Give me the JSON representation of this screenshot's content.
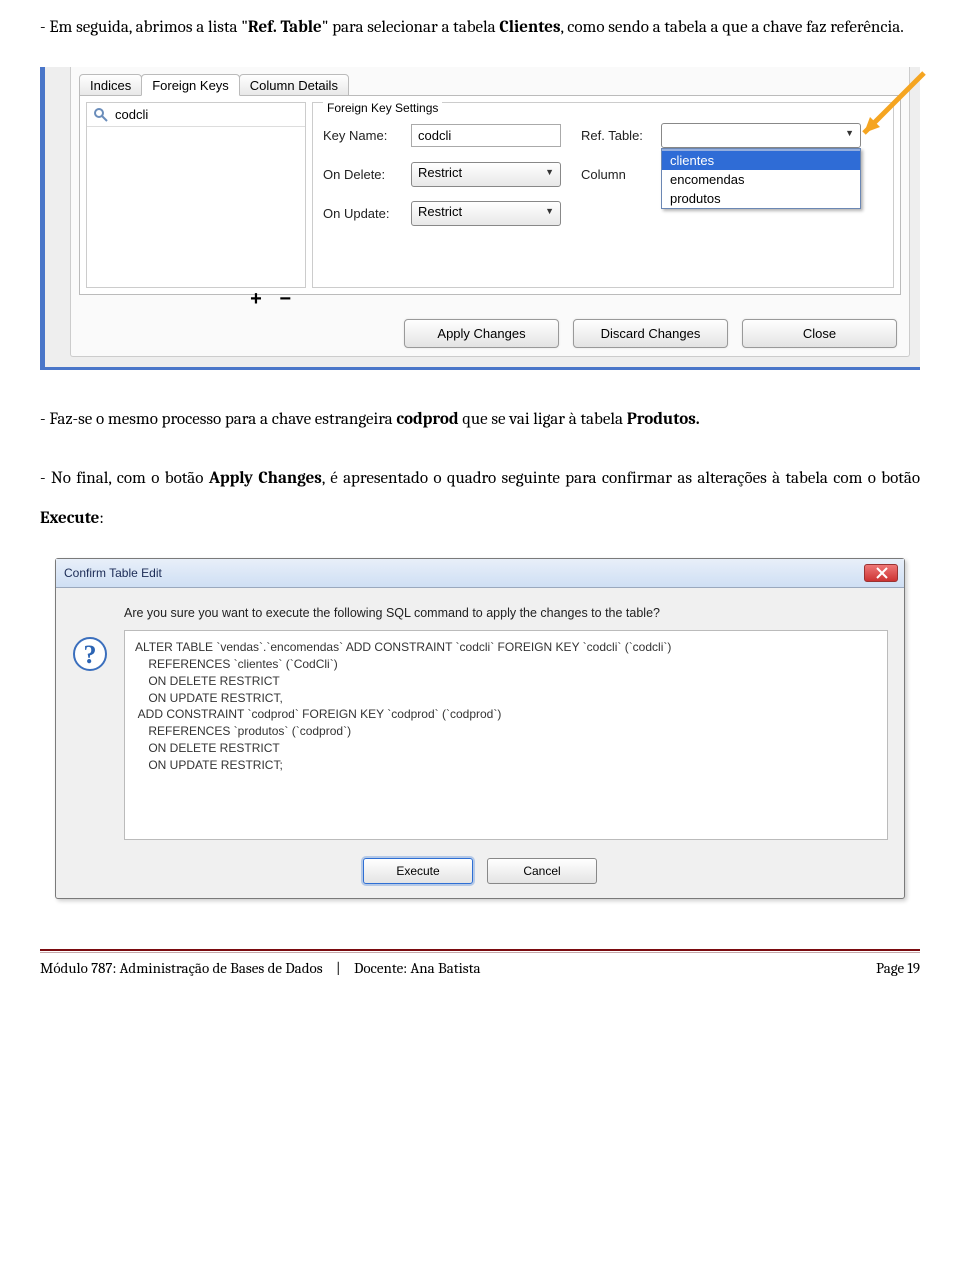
{
  "para1_a": "- Em seguida, abrimos a lista \"",
  "para1_b1": "Ref. Table",
  "para1_c": "\" para selecionar a tabela ",
  "para1_b2": "Clientes",
  "para1_d": ", como sendo a tabela a que a chave faz referência.",
  "shot1": {
    "tabs": {
      "t0": "Indices",
      "t1": "Foreign Keys",
      "t2": "Column Details"
    },
    "fk_item": "codcli",
    "plusminus": "+  −",
    "groupTitle": "Foreign Key Settings",
    "lbl_keyname": "Key Name:",
    "keyname_val": "codcli",
    "lbl_reftable": "Ref. Table:",
    "reftable_val": "",
    "lbl_col": "Column",
    "lbl_ondelete": "On Delete:",
    "ondelete_val": "Restrict",
    "lbl_onupdate": "On Update:",
    "onupdate_val": "Restrict",
    "dd": {
      "o0": "clientes",
      "o1": "encomendas",
      "o2": "produtos"
    },
    "btn_apply": "Apply Changes",
    "btn_discard": "Discard Changes",
    "btn_close": "Close"
  },
  "para2_a": "- Faz-se o mesmo processo para a chave estrangeira ",
  "para2_b1": "codprod",
  "para2_c": " que se vai ligar à tabela ",
  "para2_b2": "Produtos.",
  "para3_a": "- No final, com o botão ",
  "para3_b1": "Apply Changes",
  "para3_c": ", é apresentado o quadro seguinte para confirmar as alterações à tabela com o botão ",
  "para3_b2": "Execute",
  "para3_d": ":",
  "dlg": {
    "title": "Confirm Table Edit",
    "prompt": "Are you sure you want to execute the following SQL command to apply the changes to the table?",
    "sql": "ALTER TABLE `vendas`.`encomendas` ADD CONSTRAINT `codcli` FOREIGN KEY `codcli` (`codcli`)\n    REFERENCES `clientes` (`CodCli`)\n    ON DELETE RESTRICT\n    ON UPDATE RESTRICT,\n ADD CONSTRAINT `codprod` FOREIGN KEY `codprod` (`codprod`)\n    REFERENCES `produtos` (`codprod`)\n    ON DELETE RESTRICT\n    ON UPDATE RESTRICT;",
    "btn_exec": "Execute",
    "btn_cancel": "Cancel"
  },
  "footer": {
    "left_a": "Módulo 787: Administração de Bases de Dados",
    "sep": "|",
    "left_b": "Docente: Ana Batista",
    "right": "Page 19"
  }
}
